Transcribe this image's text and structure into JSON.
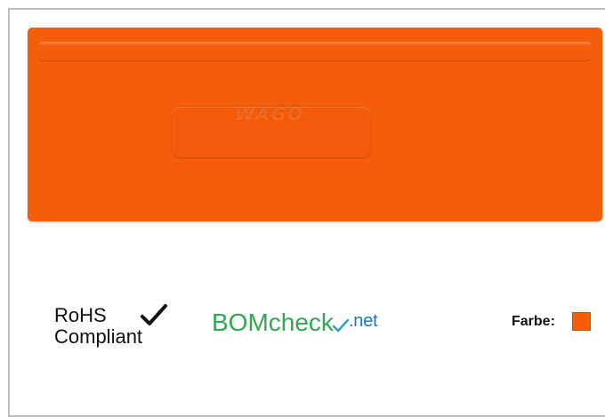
{
  "product": {
    "embossed_logo": "WAGO",
    "fill": "#f45d0a"
  },
  "compliance": {
    "rohs_line1": "RoHS",
    "rohs_line2": "Compliant",
    "rohs_check_icon": "checkmark-icon",
    "bomcheck_main": "BOMcheck",
    "bomcheck_suffix": ".net",
    "bomcheck_main_color": "#32a852",
    "bomcheck_suffix_color": "#1f74b8"
  },
  "color_info": {
    "label": "Farbe:",
    "swatch_color": "#f45d0a"
  }
}
